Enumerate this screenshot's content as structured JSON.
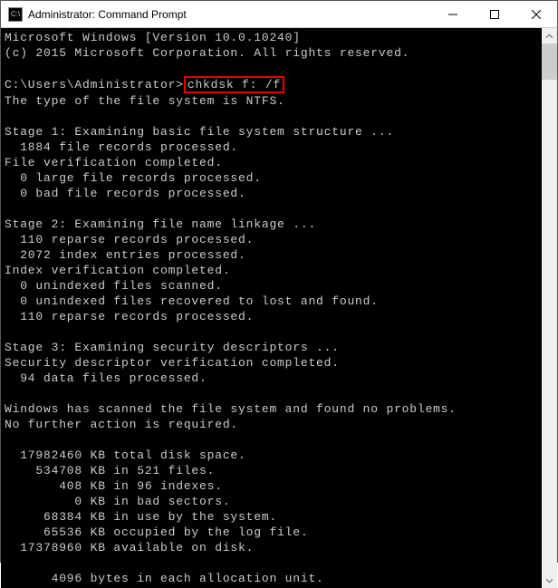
{
  "window": {
    "title": "Administrator: Command Prompt",
    "icon_label": "C:\\"
  },
  "prompt": {
    "path": "C:\\Users\\Administrator>",
    "command": "chkdsk f: /f"
  },
  "lines": {
    "l0": "Microsoft Windows [Version 10.0.10240]",
    "l1": "(c) 2015 Microsoft Corporation. All rights reserved.",
    "l2": "",
    "l4": "The type of the file system is NTFS.",
    "l5": "",
    "l6": "Stage 1: Examining basic file system structure ...",
    "l7": "  1884 file records processed.",
    "l8": "File verification completed.",
    "l9": "  0 large file records processed.",
    "l10": "  0 bad file records processed.",
    "l11": "",
    "l12": "Stage 2: Examining file name linkage ...",
    "l13": "  110 reparse records processed.",
    "l14": "  2072 index entries processed.",
    "l15": "Index verification completed.",
    "l16": "  0 unindexed files scanned.",
    "l17": "  0 unindexed files recovered to lost and found.",
    "l18": "  110 reparse records processed.",
    "l19": "",
    "l20": "Stage 3: Examining security descriptors ...",
    "l21": "Security descriptor verification completed.",
    "l22": "  94 data files processed.",
    "l23": "",
    "l24": "Windows has scanned the file system and found no problems.",
    "l25": "No further action is required.",
    "l26": "",
    "l27": "  17982460 KB total disk space.",
    "l28": "    534708 KB in 521 files.",
    "l29": "       408 KB in 96 indexes.",
    "l30": "         0 KB in bad sectors.",
    "l31": "     68384 KB in use by the system.",
    "l32": "     65536 KB occupied by the log file.",
    "l33": "  17378960 KB available on disk.",
    "l34": "",
    "l35": "      4096 bytes in each allocation unit."
  }
}
